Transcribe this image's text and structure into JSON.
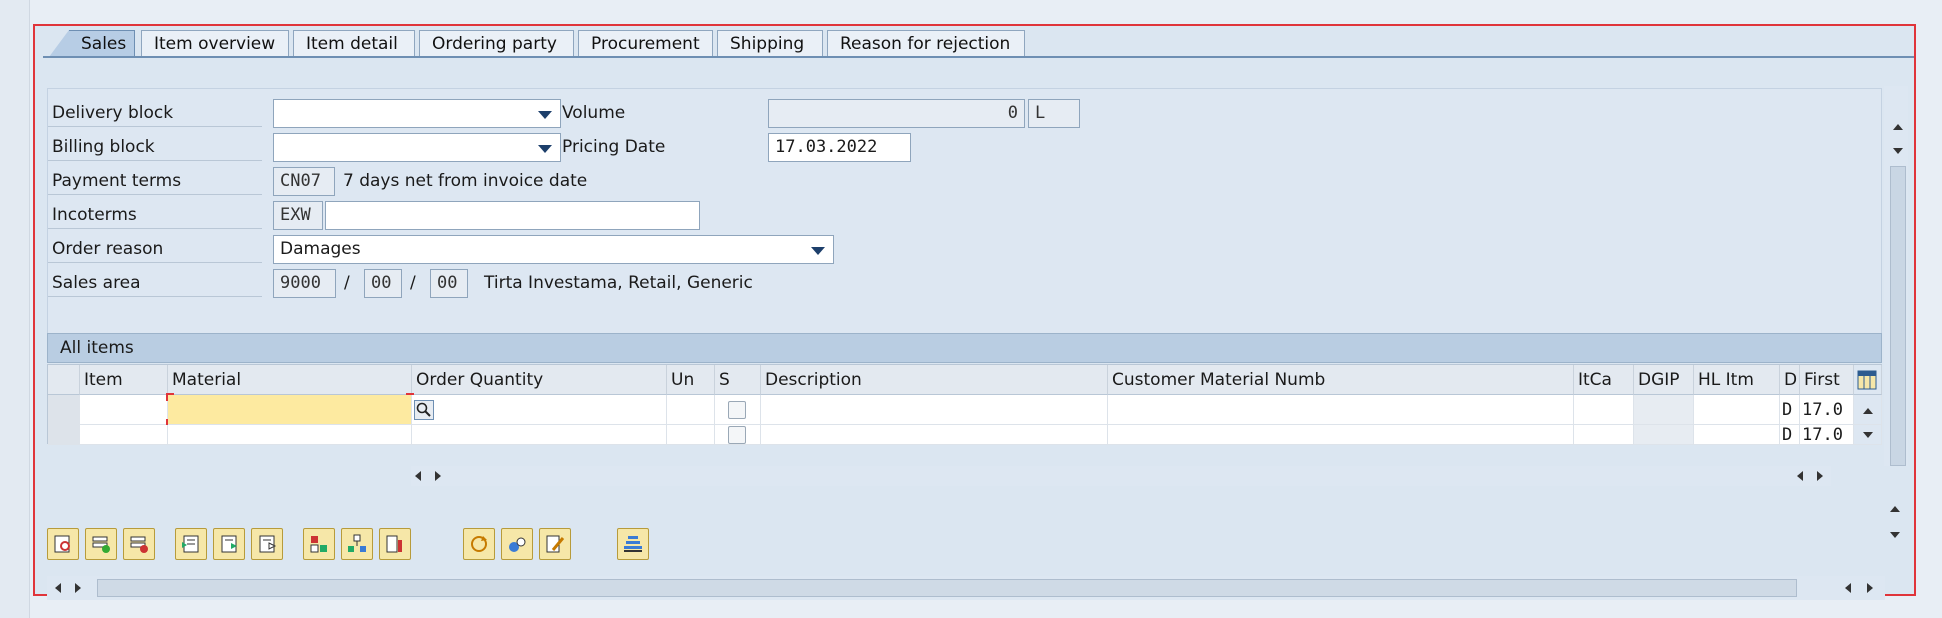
{
  "tabs": [
    "Sales",
    "Item overview",
    "Item detail",
    "Ordering party",
    "Procurement",
    "Shipping",
    "Reason for rejection"
  ],
  "header": {
    "delivery_block": {
      "label": "Delivery block",
      "value": ""
    },
    "billing_block": {
      "label": "Billing block",
      "value": ""
    },
    "volume": {
      "label": "Volume",
      "value": "0",
      "unit": "L"
    },
    "pricing_date": {
      "label": "Pricing Date",
      "value": "17.03.2022"
    },
    "payment_terms": {
      "label": "Payment terms",
      "code": "CN07",
      "text": "7 days net from invoice date"
    },
    "incoterms": {
      "label": "Incoterms",
      "code": "EXW",
      "location": ""
    },
    "order_reason": {
      "label": "Order reason",
      "value": "Damages"
    },
    "sales_area": {
      "label": "Sales area",
      "org": "9000",
      "dist": "00",
      "div": "00",
      "sep": "/",
      "text": "Tirta Investama, Retail, Generic"
    }
  },
  "items": {
    "title": "All items",
    "columns": [
      "Item",
      "Material",
      "Order Quantity",
      "Un",
      "S",
      "Description",
      "Customer Material Numb",
      "ItCa",
      "DGIP",
      "HL Itm",
      "D",
      "First"
    ],
    "rows": [
      {
        "d": "D",
        "first": "17.0"
      },
      {
        "d": "D",
        "first": "17.0"
      }
    ]
  },
  "toolbar_icons": [
    "details-icon",
    "insert-row-icon",
    "delete-row-icon",
    "select-all-icon",
    "select-block-icon",
    "deselect-icon",
    "configure-icon",
    "structure-icon",
    "report-icon",
    "refresh-icon",
    "batch-icon",
    "edit-icon",
    "sort-icon"
  ],
  "colors": {
    "frame": "#e0343a",
    "active_tab": "#b7cde5",
    "focus_cell": "#fdeaa0"
  }
}
